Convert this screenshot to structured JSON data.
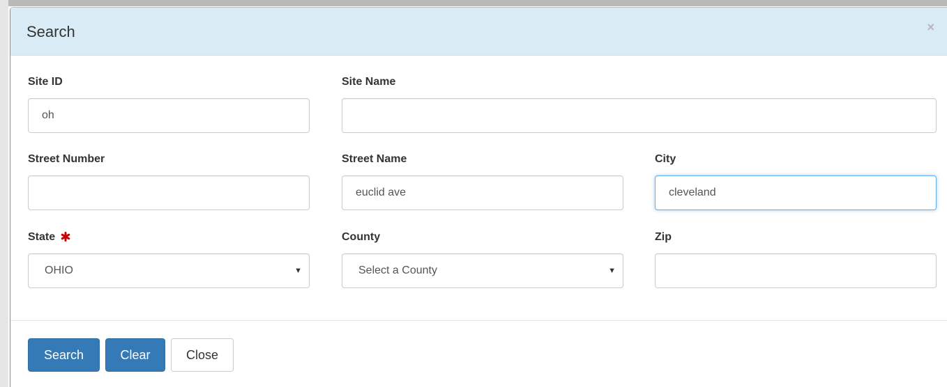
{
  "modal": {
    "title": "Search",
    "close_glyph": "×"
  },
  "fields": {
    "site_id": {
      "label": "Site ID",
      "value": "oh"
    },
    "site_name": {
      "label": "Site Name",
      "value": ""
    },
    "street_number": {
      "label": "Street Number",
      "value": ""
    },
    "street_name": {
      "label": "Street Name",
      "value": "euclid ave"
    },
    "city": {
      "label": "City",
      "value": "cleveland"
    },
    "state": {
      "label": "State",
      "selected": "OHIO",
      "required": true
    },
    "county": {
      "label": "County",
      "selected": "Select a County"
    },
    "zip": {
      "label": "Zip",
      "value": ""
    }
  },
  "buttons": {
    "search": "Search",
    "clear": "Clear",
    "close": "Close"
  },
  "icons": {
    "required": "required-asterisk-icon",
    "dropdown": "caret-down-icon",
    "close": "close-icon"
  },
  "colors": {
    "header_bg": "#d9ebf5",
    "primary": "#337ab7",
    "required": "#cc0000",
    "focus": "#66afe9"
  }
}
